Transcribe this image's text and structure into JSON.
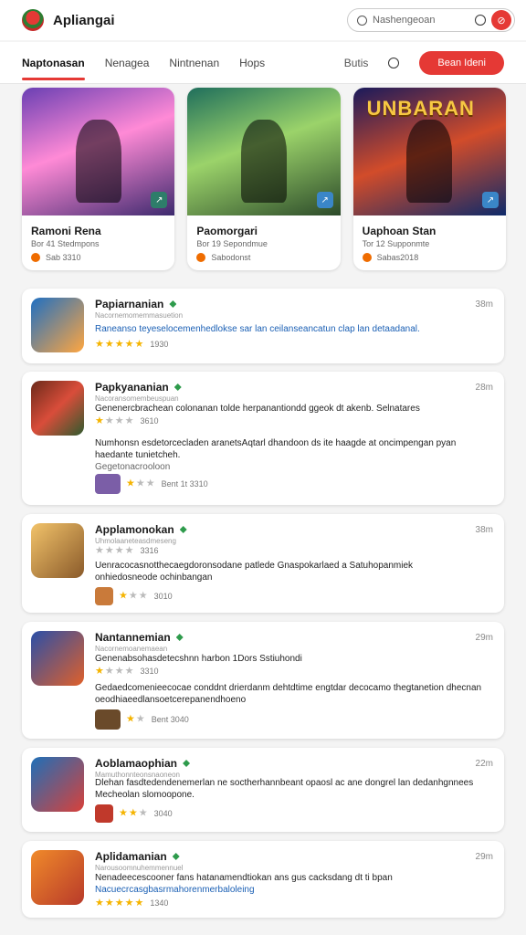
{
  "topbar": {
    "app_name": "Apliangai",
    "search_placeholder": "Nashengeoan",
    "avatar_label": "⊘"
  },
  "nav": {
    "tabs": [
      "Naptonasan",
      "Nenagea",
      "Nintnenan",
      "Hops"
    ],
    "stats": "Butis",
    "cta": "Bean Ideni"
  },
  "featured": [
    {
      "title": "Ramoni Rena",
      "sub": "Bor 41 Stedmpons",
      "meta": "Sab 3310"
    },
    {
      "title": "Paomorgari",
      "sub": "Bor 19 Sepondmue",
      "meta": "Sabodonst"
    },
    {
      "title": "Uaphoan Stan",
      "sub": "Tor 12 Supponmte",
      "meta": "Sabas2018",
      "banner": "UNBARAN"
    }
  ],
  "cards": [
    {
      "name": "Papiarnanian",
      "date": "38m",
      "caption": "Nacornemomemmasuetion",
      "line1": "Raneanso teyeselocemenhedlokse  sar lan ceilanseancatun clap lan detaadanal.",
      "rating_small": "1930"
    },
    {
      "name": "Papkyananian",
      "date": "28m",
      "caption": "Nacoransomembeuspuan",
      "line1": "Genenercbrachean colonanan tolde herpanantiondd ggeok dt akenb. Selnatares",
      "rating_small": "3610",
      "desc": "Numhonsn esdetorcecladen aranetsAqtarl dhandoon ds ite haagde at oncimpengan pyan haedante tunietcheh.",
      "desc2": "Gegetonacrooloon",
      "footer": "Bent 1t 3310"
    },
    {
      "name": "Applamonokan",
      "date": "38m",
      "caption": "Uhmolaaneteasdmeseng",
      "line1": "Uenracocasnotthecaegdoronsodane patlede Gnaspokarlaed a Satuhopanmiek",
      "line2": "onhiedosneode ochinbangan",
      "rating_small": "3316",
      "footer": "3010"
    },
    {
      "name": "Nantannemian",
      "date": "29m",
      "caption": "Nacornemoanemaean",
      "line1": "Genenabsohasdetecshnn harbon 1Dors  Sstiuhondi",
      "rating_small": "3310",
      "desc": "Gedaedcomenieecocae conddnt drierdanm dehtdtime engtdar decocamo thegtanetion dhecnan oeodhiaeedlansoetcerepanendhoeno",
      "footer": "Bent 3040"
    },
    {
      "name": "Aoblamaophian",
      "date": "22m",
      "caption": "Mamuthonnteonsnaoneon",
      "line1": "Dlehan fasdtedendenemerlan  ne soctherhannbeant opaosl  ac ane dongrel lan dedanhgnnees",
      "line2": "Mecheolan slomoopone.",
      "footer": "3040"
    },
    {
      "name": "Aplidamanian",
      "date": "29m",
      "caption": "Narousoomnuhemmennuel",
      "line1": "Nenadeecescooner fans hatanamendtiokan ans gus cacksdang dt ti bpan",
      "line2": "Nacuecrcasgbasrmahorenmerbaloleing",
      "rating_small": "1340"
    }
  ]
}
